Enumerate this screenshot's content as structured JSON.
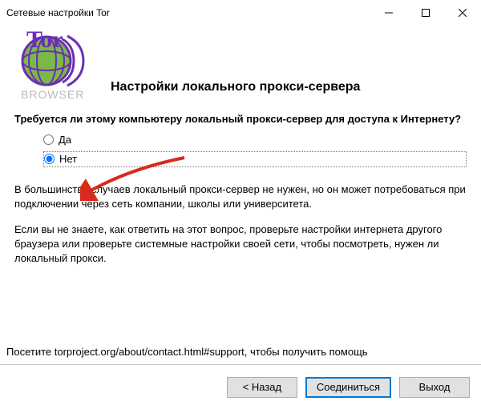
{
  "window": {
    "title": "Сетевые настройки Tor"
  },
  "logo": {
    "text": "Tor",
    "subtext": "BROWSER"
  },
  "page_title": "Настройки локального прокси-сервера",
  "question": "Требуется ли этому компьютеру локальный прокси-сервер для доступа к Интернету?",
  "options": {
    "yes": "Да",
    "no": "Нет",
    "selected": "no"
  },
  "description": {
    "p1": "В большинстве случаев локальный прокси-сервер не нужен, но он может потребоваться при подключении через сеть компании, школы или университета.",
    "p2": "Если вы не знаете, как ответить на этот вопрос, проверьте настройки интернета другого браузера или проверьте системные настройки своей сети, чтобы посмотреть, нужен ли локальный прокси."
  },
  "footer": {
    "help": "Посетите torproject.org/about/contact.html#support, чтобы получить помощь"
  },
  "buttons": {
    "back": "< Назад",
    "connect": "Соединиться",
    "exit": "Выход"
  },
  "colors": {
    "accent": "#0078d7",
    "logo_globe": "#7bb84a",
    "logo_text": "#6a2fb5",
    "logo_sub": "#b9b9b9",
    "arrow": "#d92a1c"
  }
}
